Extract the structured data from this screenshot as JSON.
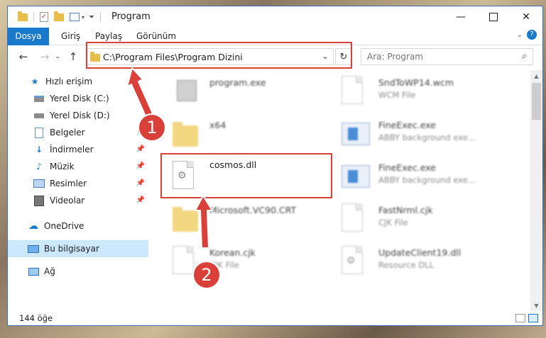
{
  "window": {
    "title": "Program"
  },
  "ribbon": {
    "tabs": [
      "Dosya",
      "Giriş",
      "Paylaş",
      "Görünüm"
    ]
  },
  "address": {
    "path": "C:\\Program Files\\Program Dizini"
  },
  "search": {
    "placeholder": "Ara: Program"
  },
  "sidebar": {
    "items": [
      {
        "label": "Hızlı erişim",
        "icon": "star-icon",
        "pinned": false
      },
      {
        "label": "Yerel Disk (C:)",
        "icon": "drive-icon",
        "pinned": false
      },
      {
        "label": "Yerel Disk (D:)",
        "icon": "drive-icon",
        "pinned": false
      },
      {
        "label": "Belgeler",
        "icon": "documents-icon",
        "pinned": true
      },
      {
        "label": "İndirmeler",
        "icon": "download-icon",
        "pinned": true
      },
      {
        "label": "Müzik",
        "icon": "music-icon",
        "pinned": true
      },
      {
        "label": "Resimler",
        "icon": "pictures-icon",
        "pinned": true
      },
      {
        "label": "Videolar",
        "icon": "videos-icon",
        "pinned": true
      },
      {
        "label": "OneDrive",
        "icon": "cloud-icon",
        "pinned": false
      },
      {
        "label": "Bu bilgisayar",
        "icon": "computer-icon",
        "pinned": false
      },
      {
        "label": "Ağ",
        "icon": "network-icon",
        "pinned": false
      }
    ]
  },
  "files": [
    {
      "name": "program.exe",
      "type": "",
      "icon": "program-icon"
    },
    {
      "name": "SndToWP14.wcm",
      "type": "WCM File",
      "icon": "document-icon"
    },
    {
      "name": "x64",
      "type": "",
      "icon": "folder-icon"
    },
    {
      "name": "FineExec.exe",
      "type": "ABBY background exe...",
      "icon": "exe-icon"
    },
    {
      "name": "cosmos.dll",
      "type": "",
      "icon": "dll-icon"
    },
    {
      "name": "FineExec.exe",
      "type": "ABBY background exe...",
      "icon": "exe-icon"
    },
    {
      "name": "Microsoft.VC90.CRT",
      "type": "",
      "icon": "folder-icon"
    },
    {
      "name": "FastNrml.cjk",
      "type": "CJK File",
      "icon": "document-icon"
    },
    {
      "name": "Korean.cjk",
      "type": "CJK File",
      "icon": "document-icon"
    },
    {
      "name": "UpdateClient19.dll",
      "type": "Resource DLL",
      "icon": "dll-icon"
    }
  ],
  "status": {
    "count": "144 öğe"
  },
  "annotations": {
    "step1": "1",
    "step2": "2",
    "color": "#d9403a"
  }
}
